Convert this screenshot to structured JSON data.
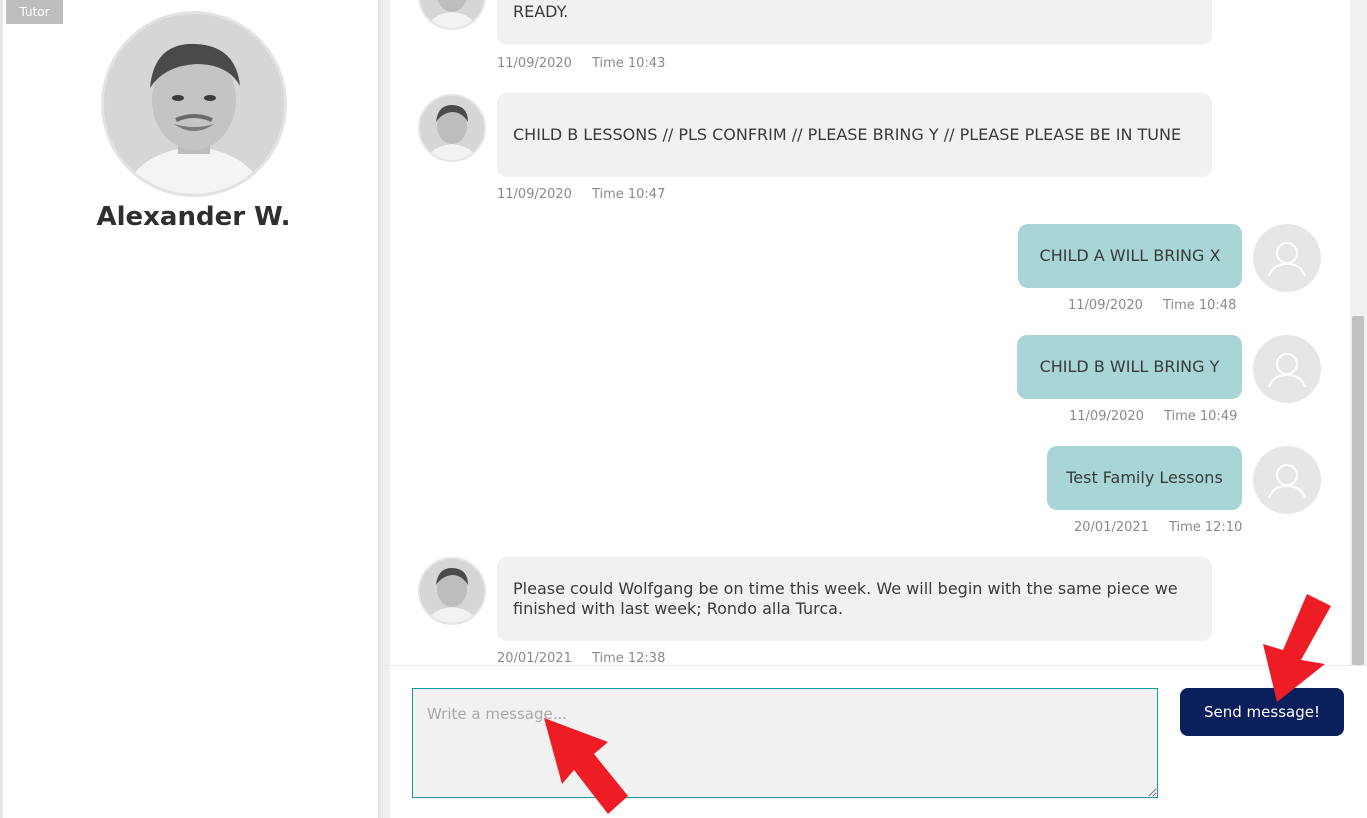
{
  "sidebar": {
    "badge": "Tutor",
    "tutor_name": "Alexander W."
  },
  "messages": [
    {
      "side": "in",
      "text": "READY.",
      "date": "11/09/2020",
      "time": "Time 10:43"
    },
    {
      "side": "in",
      "text": "CHILD B LESSONS // PLS CONFRIM // PLEASE BRING Y // PLEASE PLEASE BE IN TUNE",
      "date": "11/09/2020",
      "time": "Time 10:47"
    },
    {
      "side": "out",
      "text": "CHILD A WILL BRING X",
      "date": "11/09/2020",
      "time": "Time 10:48"
    },
    {
      "side": "out",
      "text": "CHILD B WILL BRING Y",
      "date": "11/09/2020",
      "time": "Time 10:49"
    },
    {
      "side": "out",
      "text": "Test Family Lessons",
      "date": "20/01/2021",
      "time": "Time 12:10"
    },
    {
      "side": "in",
      "text": "Please could Wolfgang be on time this week. We will begin with the same piece we finished with last week; Rondo alla Turca.",
      "date": "20/01/2021",
      "time": "Time 12:38"
    }
  ],
  "composer": {
    "placeholder": "Write a message...",
    "value": "",
    "send_label": "Send message!"
  },
  "colors": {
    "send_button": "#0b1f5c",
    "outgoing_bubble": "#a8d5d5",
    "incoming_bubble": "#f1f1f1",
    "input_border": "#1a9aa0",
    "annotation_arrow": "#ee1c24"
  }
}
